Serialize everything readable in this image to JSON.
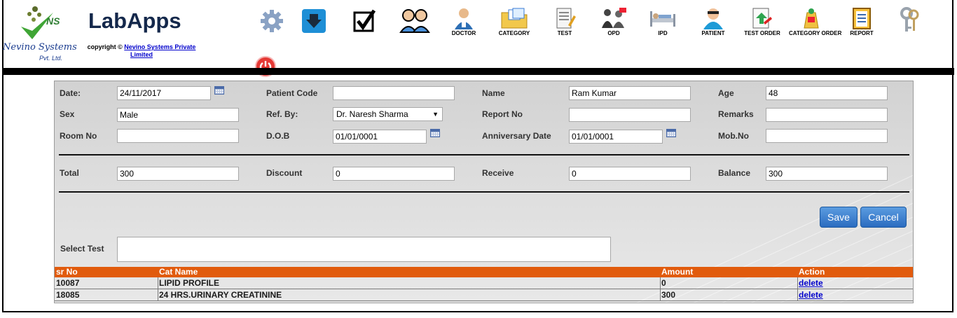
{
  "brand": {
    "logo_ns": "NS",
    "logo_company": "Nevino Systems",
    "logo_pvt": "Pvt. Ltd.",
    "app_title": "LabApps",
    "copyright_prefix": "copyright ©",
    "copyright_link": "Nevino Systems Private Limited"
  },
  "toolbar": {
    "items": [
      {
        "label": "",
        "icon": "gear-icon"
      },
      {
        "label": "",
        "icon": "download-box-icon"
      },
      {
        "label": "",
        "icon": "checkbox-icon"
      },
      {
        "label": "",
        "icon": "users-icon"
      },
      {
        "label": "DOCTOR",
        "icon": "doctor-icon"
      },
      {
        "label": "CATEGORY",
        "icon": "folder-icon"
      },
      {
        "label": "TEST",
        "icon": "test-document-icon"
      },
      {
        "label": "OPD",
        "icon": "opd-icon"
      },
      {
        "label": "IPD",
        "icon": "hospital-bed-icon"
      },
      {
        "label": "PATIENT",
        "icon": "patient-icon"
      },
      {
        "label": "TEST ORDER",
        "icon": "test-order-icon"
      },
      {
        "label": "CATEGORY ORDER",
        "icon": "category-order-icon"
      },
      {
        "label": "REPORT",
        "icon": "report-icon"
      },
      {
        "label": "",
        "icon": "keys-icon"
      }
    ],
    "power_icon": "power-icon"
  },
  "form": {
    "date_label": "Date:",
    "date_value": "24/11/2017",
    "patient_code_label": "Patient Code",
    "patient_code_value": "",
    "name_label": "Name",
    "name_value": "Ram Kumar",
    "age_label": "Age",
    "age_value": "48",
    "sex_label": "Sex",
    "sex_value": "Male",
    "refby_label": "Ref. By:",
    "refby_value": "Dr. Naresh Sharma",
    "report_no_label": "Report No",
    "report_no_value": "",
    "remarks_label": "Remarks",
    "remarks_value": "",
    "room_no_label": "Room No",
    "room_no_value": "",
    "dob_label": "D.O.B",
    "dob_value": "01/01/0001",
    "anniversary_label": "Anniversary Date",
    "anniversary_value": "01/01/0001",
    "mobno_label": "Mob.No",
    "mobno_value": "",
    "total_label": "Total",
    "total_value": "300",
    "discount_label": "Discount",
    "discount_value": "0",
    "receive_label": "Receive",
    "receive_value": "0",
    "balance_label": "Balance",
    "balance_value": "300",
    "save_label": "Save",
    "cancel_label": "Cancel",
    "select_test_label": "Select Test",
    "select_test_value": ""
  },
  "table": {
    "columns": [
      "sr No",
      "Cat Name",
      "Amount",
      "Action"
    ],
    "rows": [
      {
        "sr_no": "10087",
        "cat_name": "LIPID PROFILE",
        "amount": "0",
        "action": "delete"
      },
      {
        "sr_no": "18085",
        "cat_name": "24 HRS.URINARY CREATININE",
        "amount": "300",
        "action": "delete"
      }
    ]
  },
  "colors": {
    "table_header": "#e15b0d",
    "button": "#2b6cc0",
    "title": "#14284b",
    "power": "#e53935"
  }
}
